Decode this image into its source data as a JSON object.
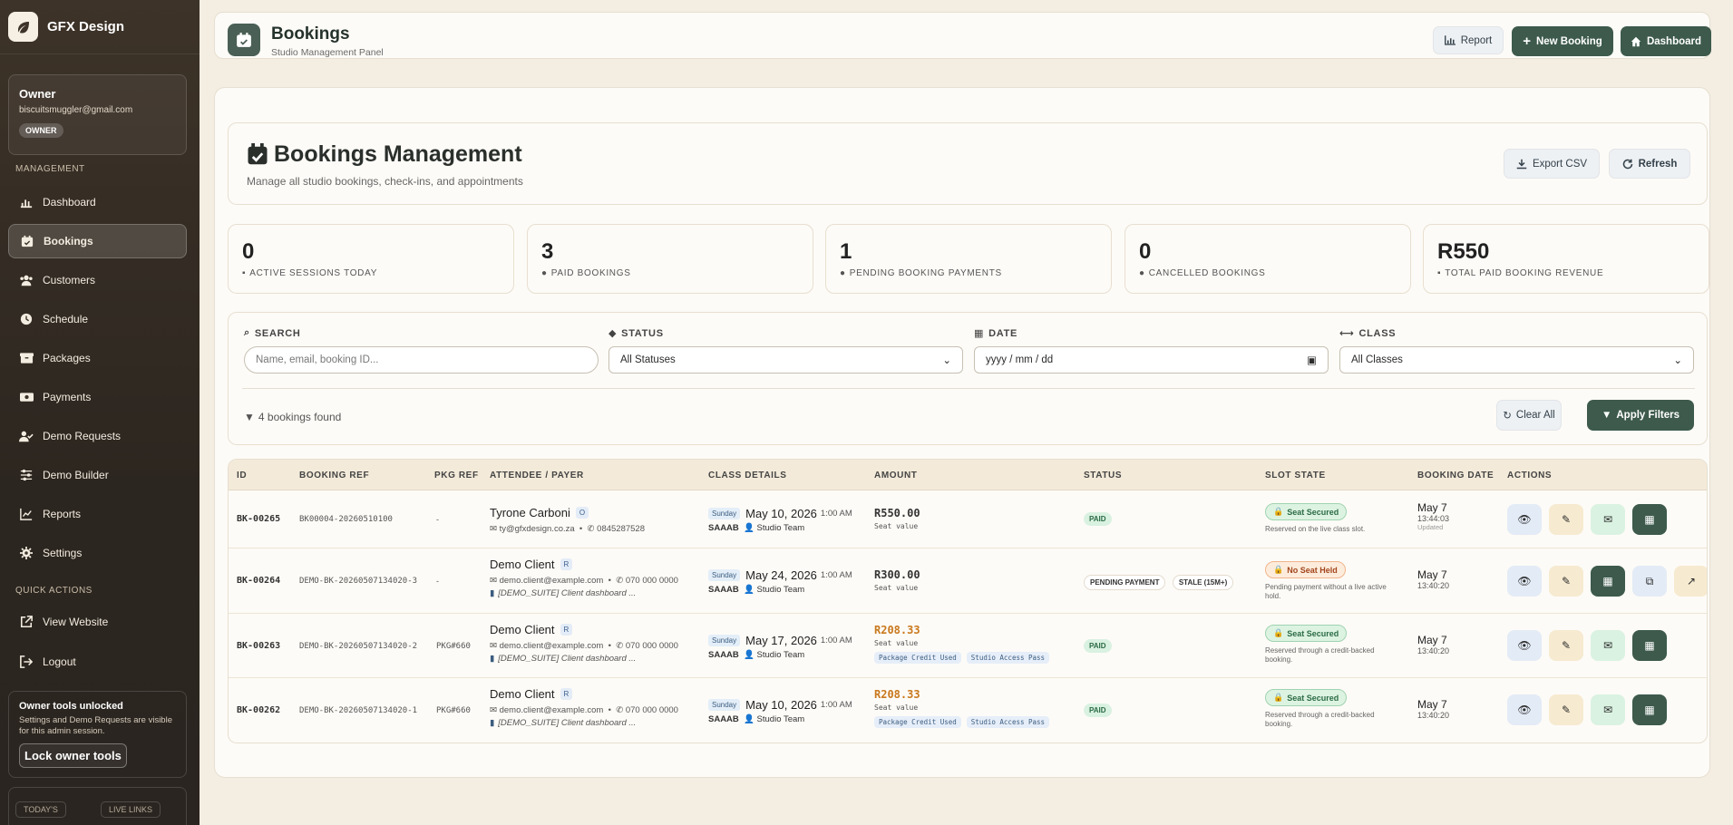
{
  "brand": {
    "name": "GFX Design"
  },
  "owner": {
    "title": "Owner",
    "email": "biscuitsmuggler@gmail.com",
    "badge": "OWNER"
  },
  "sidebar": {
    "management_label": "MANAGEMENT",
    "items": [
      {
        "label": "Dashboard",
        "icon": "dashboard-icon"
      },
      {
        "label": "Bookings",
        "icon": "calendar-check-icon"
      },
      {
        "label": "Customers",
        "icon": "users-icon"
      },
      {
        "label": "Schedule",
        "icon": "clock-icon"
      },
      {
        "label": "Packages",
        "icon": "box-icon"
      },
      {
        "label": "Payments",
        "icon": "money-icon"
      },
      {
        "label": "Demo Requests",
        "icon": "user-check-icon"
      },
      {
        "label": "Demo Builder",
        "icon": "sliders-icon"
      },
      {
        "label": "Reports",
        "icon": "chart-line-icon"
      },
      {
        "label": "Settings",
        "icon": "gear-icon"
      }
    ],
    "quick_label": "QUICK ACTIONS",
    "quick": [
      {
        "label": "View Website",
        "icon": "external-link-icon"
      },
      {
        "label": "Logout",
        "icon": "logout-icon"
      }
    ],
    "unlock": {
      "title": "Owner tools unlocked",
      "text": "Settings and Demo Requests are visible for this admin session.",
      "button": "Lock owner tools"
    },
    "bottom_pills": [
      "TODAY'S",
      "LIVE LINKS"
    ]
  },
  "topbar": {
    "title": "Bookings",
    "subtitle": "Studio Management Panel",
    "report": "Report",
    "new_booking": "New Booking",
    "dashboard": "Dashboard"
  },
  "header": {
    "title": "Bookings Management",
    "subtitle": "Manage all studio bookings, check-ins, and appointments",
    "export": "Export CSV",
    "refresh": "Refresh"
  },
  "stats": [
    {
      "value": "0",
      "label": "ACTIVE SESSIONS TODAY"
    },
    {
      "value": "3",
      "label": "PAID BOOKINGS"
    },
    {
      "value": "1",
      "label": "PENDING BOOKING PAYMENTS"
    },
    {
      "value": "0",
      "label": "CANCELLED BOOKINGS"
    },
    {
      "value": "R550",
      "label": "TOTAL PAID BOOKING REVENUE"
    }
  ],
  "filters": {
    "search_label": "SEARCH",
    "search_placeholder": "Name, email, booking ID...",
    "status_label": "STATUS",
    "status_value": "All Statuses",
    "date_label": "DATE",
    "date_placeholder": "yyyy / mm / dd",
    "class_label": "CLASS",
    "class_value": "All Classes",
    "found": "4 bookings found",
    "clear": "Clear All",
    "apply": "Apply Filters"
  },
  "table": {
    "headers": [
      "ID",
      "BOOKING REF",
      "PKG REF",
      "ATTENDEE / PAYER",
      "CLASS DETAILS",
      "AMOUNT",
      "STATUS",
      "SLOT STATE",
      "BOOKING DATE",
      "ACTIONS"
    ],
    "rows": [
      {
        "id": "BK-00265",
        "ref": "BK00004-20260510100",
        "pkg": "-",
        "name": "Tyrone Carboni",
        "tag": "O",
        "email": "ty@gfxdesign.co.za",
        "phone": "0845287528",
        "note": "",
        "day": "Sunday",
        "date": "May 10, 2026",
        "time": "1:00 AM",
        "venue": "SAAAB",
        "team": "Studio Team",
        "amount": "R550.00",
        "seat": "Seat value",
        "chips": [],
        "status": [
          "PAID"
        ],
        "slot": "Seat Secured",
        "slot_desc": "Reserved on the live class slot.",
        "bdate": "May 7",
        "btime": "13:44:03",
        "updated": "Updated"
      },
      {
        "id": "BK-00264",
        "ref": "DEMO-BK-20260507134020-3",
        "pkg": "-",
        "name": "Demo Client",
        "tag": "R",
        "email": "demo.client@example.com",
        "phone": "070 000 0000",
        "note": "[DEMO_SUITE] Client dashboard ...",
        "day": "Sunday",
        "date": "May 24, 2026",
        "time": "1:00 AM",
        "venue": "SAAAB",
        "team": "Studio Team",
        "amount": "R300.00",
        "seat": "Seat value",
        "chips": [],
        "status": [
          "PENDING PAYMENT",
          "STALE (15M+)"
        ],
        "slot": "No Seat Held",
        "slot_desc": "Pending payment without a live active hold.",
        "bdate": "May 7",
        "btime": "13:40:20",
        "updated": ""
      },
      {
        "id": "BK-00263",
        "ref": "DEMO-BK-20260507134020-2",
        "pkg": "PKG#660",
        "name": "Demo Client",
        "tag": "R",
        "email": "demo.client@example.com",
        "phone": "070 000 0000",
        "note": "[DEMO_SUITE] Client dashboard ...",
        "day": "Sunday",
        "date": "May 17, 2026",
        "time": "1:00 AM",
        "venue": "SAAAB",
        "team": "Studio Team",
        "amount": "R208.33",
        "seat": "Seat value",
        "chips": [
          "Package Credit Used",
          "Studio Access Pass"
        ],
        "status": [
          "PAID"
        ],
        "slot": "Seat Secured",
        "slot_desc": "Reserved through a credit-backed booking.",
        "bdate": "May 7",
        "btime": "13:40:20",
        "updated": ""
      },
      {
        "id": "BK-00262",
        "ref": "DEMO-BK-20260507134020-1",
        "pkg": "PKG#660",
        "name": "Demo Client",
        "tag": "R",
        "email": "demo.client@example.com",
        "phone": "070 000 0000",
        "note": "[DEMO_SUITE] Client dashboard ...",
        "day": "Sunday",
        "date": "May 10, 2026",
        "time": "1:00 AM",
        "venue": "SAAAB",
        "team": "Studio Team",
        "amount": "R208.33",
        "seat": "Seat value",
        "chips": [
          "Package Credit Used",
          "Studio Access Pass"
        ],
        "status": [
          "PAID"
        ],
        "slot": "Seat Secured",
        "slot_desc": "Reserved through a credit-backed booking.",
        "bdate": "May 7",
        "btime": "13:40:20",
        "updated": ""
      }
    ]
  },
  "colors": {
    "accent": "#3d5a4c",
    "sidebar": "#2c2620",
    "background": "#f3ede2",
    "warning": "#c9781c"
  }
}
